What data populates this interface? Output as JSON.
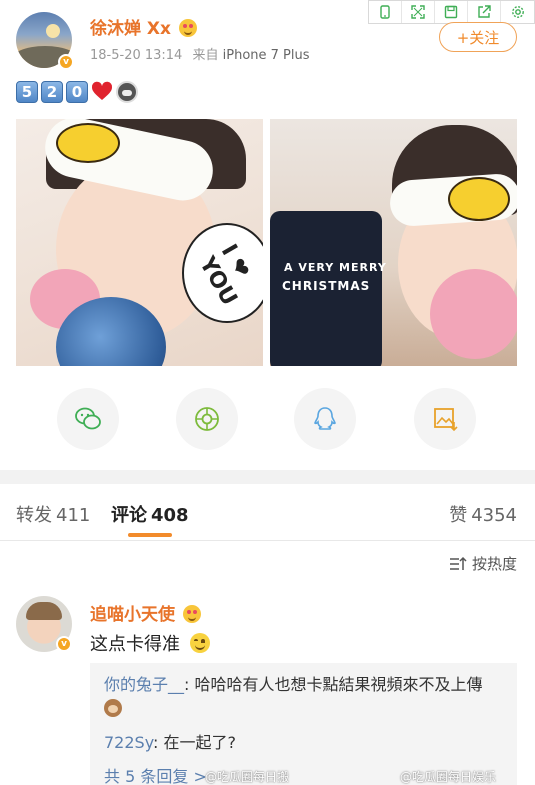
{
  "toolbar": {
    "icons": [
      "phone-icon",
      "expand-icon",
      "save-icon",
      "share-out-icon",
      "settings-icon"
    ]
  },
  "post": {
    "username": "徐沐婵 Xx",
    "timestamp": "18-5-20 13:14",
    "source_prefix": "来自",
    "source_device": "iPhone 7 Plus",
    "follow_label": "+关注",
    "text_keycaps": [
      "5",
      "2",
      "0"
    ],
    "photos": [
      {
        "bubble_text": "I ❤ YOU"
      },
      {
        "phone_text_1": "A VERY MERRY",
        "phone_text_2": "CHRISTMAS"
      }
    ]
  },
  "share": {
    "items": [
      "wechat-icon",
      "moments-icon",
      "qq-icon",
      "save-image-icon"
    ]
  },
  "tabs": {
    "repost": {
      "label": "转发",
      "count": "411"
    },
    "comment": {
      "label": "评论",
      "count": "408"
    },
    "like": {
      "label": "赞",
      "count": "4354"
    }
  },
  "sort": {
    "label": "按热度"
  },
  "comment": {
    "username": "追喵小天使",
    "text": "这点卡得准",
    "replies": [
      {
        "name": "你的兔子__",
        "text": ": 哈哈哈有人也想卡點結果視頻來不及上傳"
      },
      {
        "name": "722Sy",
        "text": ": 在一起了?"
      }
    ],
    "more_label": "共 5 条回复 >"
  },
  "watermarks": [
    "@吃瓜圈每日搬",
    "@吃瓜圈每日娱乐"
  ],
  "colors": {
    "accent_orange": "#e8742b",
    "link_blue": "#5b7fae",
    "tab_underline": "#f28b2b"
  }
}
